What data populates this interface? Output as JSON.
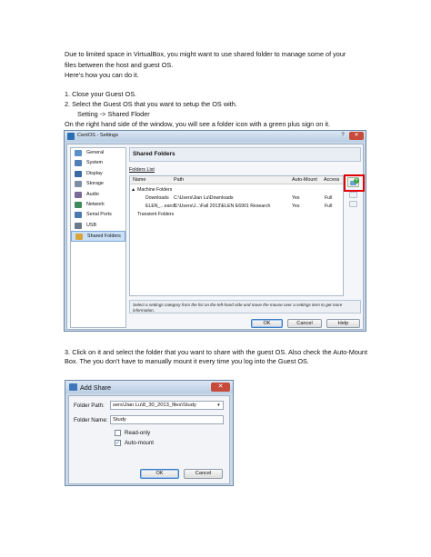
{
  "intro": {
    "line1": "Due to limited space in VirtualBox, you might want to use shared folder to manage some of your",
    "line2": "files between the host and guest OS.",
    "line3": "Here's how you can do it."
  },
  "steps": {
    "step1": "1. Close your Guest OS.",
    "step2": "2. Select the Guest OS that you want to setup the OS with.",
    "step2_sub": "Setting -> Shared Floder",
    "step2_note": "On the right hand side of the window, you will see a folder icon with a green plus sign on it.",
    "step3": "3. Click on it and select the folder that you want to share with the guest OS. Also check the Auto-Mount Box. The you don't have to manually mount it every time you log into the Guest OS."
  },
  "settings_window": {
    "title": "CentOS - Settings",
    "help_glyph": "?",
    "close_glyph": "✕",
    "nav_items": [
      {
        "label": "General",
        "color": "#5b8fc7"
      },
      {
        "label": "System",
        "color": "#4f7fb6"
      },
      {
        "label": "Display",
        "color": "#3a6aa3"
      },
      {
        "label": "Storage",
        "color": "#7f8fa3"
      },
      {
        "label": "Audio",
        "color": "#7a6a9a"
      },
      {
        "label": "Network",
        "color": "#3f8a5a"
      },
      {
        "label": "Serial Ports",
        "color": "#4a7ab0"
      },
      {
        "label": "USB",
        "color": "#6a7a8a"
      },
      {
        "label": "Shared Folders",
        "color": "#d7a53a"
      }
    ],
    "selected_nav": "Shared Folders",
    "section_title": "Shared Folders",
    "group_label": "Folders List",
    "columns": {
      "name": "Name",
      "path": "Path",
      "auto_mount": "Auto-Mount",
      "access": "Access"
    },
    "rows": [
      {
        "name": "Machine Folders",
        "path": "",
        "auto_mount": "",
        "access": "",
        "prefix": "▲"
      },
      {
        "name": "Downloads",
        "path": "C:\\Users\\Jian Lu\\Downloads",
        "auto_mount": "Yes",
        "access": "Full",
        "prefix": ""
      },
      {
        "name": "ELEN_...earch",
        "path": "C:\\Users\\J...\\Fall 2013\\ELEN E6901 Research",
        "auto_mount": "Yes",
        "access": "Full",
        "prefix": ""
      },
      {
        "name": "Transient Folders",
        "path": "",
        "auto_mount": "",
        "access": "",
        "prefix": ""
      }
    ],
    "add_plus": "+",
    "info_text": "Select a settings category from the list on the left-hand side and move the mouse over a settings item to get more information.",
    "ok_label": "OK",
    "cancel_label": "Cancel",
    "help_label": "Help",
    "highlight_color": "#e00000"
  },
  "add_share_dialog": {
    "title": "Add Share",
    "close_glyph": "✕",
    "folder_path_label": "Folder Path:",
    "folder_path_value": "sers\\Jian Lu\\8_30_2013_files\\Study",
    "dropdown_glyph": "▾",
    "folder_name_label": "Folder Name:",
    "folder_name_value": "Study",
    "readonly_label": "Read-only",
    "readonly_checked": false,
    "automount_label": "Auto-mount",
    "automount_checked": true,
    "check_glyph": "✓",
    "ok_label": "OK",
    "cancel_label": "Cancel"
  }
}
